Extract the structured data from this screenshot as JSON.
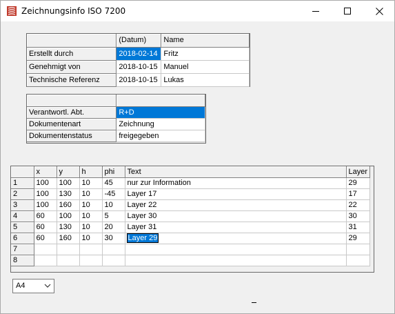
{
  "window": {
    "title": "Zeichnungsinfo ISO 7200"
  },
  "icons": {
    "app": "app-icon",
    "minimize": "minimize-icon",
    "maximize": "maximize-icon",
    "close": "close-icon",
    "dropdown": "chevron-down-icon"
  },
  "colors": {
    "selection": "#0078d7",
    "background": "#f0f0f0",
    "close_hover": "#e81123"
  },
  "grid1": {
    "headers": [
      "",
      "(Datum)",
      "Name"
    ],
    "rows": [
      {
        "label": "Erstellt durch",
        "date": "2018-02-14",
        "name": "Fritz"
      },
      {
        "label": "Genehmigt von",
        "date": "2018-10-15",
        "name": "Manuel"
      },
      {
        "label": "Technische Referenz",
        "date": "2018-10-15",
        "name": "Lukas"
      }
    ]
  },
  "grid2": {
    "headers": [
      "",
      ""
    ],
    "rows": [
      {
        "label": "Verantwortl. Abt.",
        "value": "R+D"
      },
      {
        "label": "Dokumentenart",
        "value": "Zeichnung"
      },
      {
        "label": "Dokumentenstatus",
        "value": "freigegeben"
      }
    ]
  },
  "grid3": {
    "headers": [
      "",
      "x",
      "y",
      "h",
      "phi",
      "Text",
      "Layer"
    ],
    "rows": [
      {
        "n": "1",
        "x": "100",
        "y": "100",
        "h": "10",
        "phi": "45",
        "text": "nur zur Information",
        "layer": "29"
      },
      {
        "n": "2",
        "x": "100",
        "y": "130",
        "h": "10",
        "phi": "-45",
        "text": "Layer 17",
        "layer": "17"
      },
      {
        "n": "3",
        "x": "100",
        "y": "160",
        "h": "10",
        "phi": "10",
        "text": "Layer 22",
        "layer": "22"
      },
      {
        "n": "4",
        "x": "60",
        "y": "100",
        "h": "10",
        "phi": "5",
        "text": "Layer 30",
        "layer": "30"
      },
      {
        "n": "5",
        "x": "60",
        "y": "130",
        "h": "10",
        "phi": "20",
        "text": "Layer 31",
        "layer": "31"
      },
      {
        "n": "6",
        "x": "60",
        "y": "160",
        "h": "10",
        "phi": "30",
        "text": "Layer  29",
        "layer": "29"
      },
      {
        "n": "7",
        "x": "",
        "y": "",
        "h": "",
        "phi": "",
        "text": "",
        "layer": ""
      },
      {
        "n": "8",
        "x": "",
        "y": "",
        "h": "",
        "phi": "",
        "text": "",
        "layer": ""
      }
    ]
  },
  "paper_size": {
    "selected": "A4"
  }
}
